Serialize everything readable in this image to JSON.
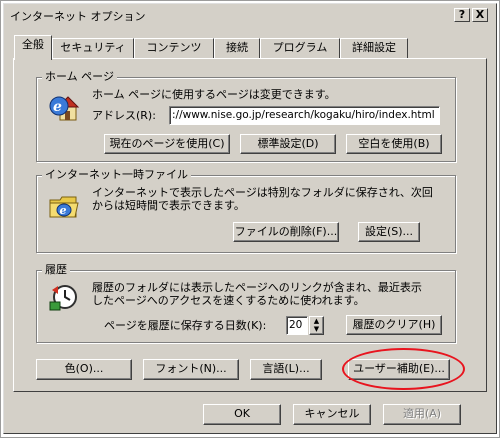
{
  "window": {
    "title": "インターネット オプション",
    "help_label": "?",
    "close_label": "X"
  },
  "tabs": [
    {
      "label": "全般",
      "active": true
    },
    {
      "label": "セキュリティ",
      "active": false
    },
    {
      "label": "コンテンツ",
      "active": false
    },
    {
      "label": "接続",
      "active": false
    },
    {
      "label": "プログラム",
      "active": false
    },
    {
      "label": "詳細設定",
      "active": false
    }
  ],
  "home_page": {
    "legend": "ホーム ページ",
    "description": "ホーム ページに使用するページは変更できます。",
    "address_label": "アドレス(R):",
    "address_value": "://www.nise.go.jp/research/kogaku/hiro/index.html",
    "btn_use_current": "現在のページを使用(C)",
    "btn_use_default": "標準設定(D)",
    "btn_use_blank": "空白を使用(B)",
    "icon": "home-page-icon"
  },
  "temp_files": {
    "legend": "インターネット一時ファイル",
    "description_line1": "インターネットで表示したページは特別なフォルダに保存され、次回",
    "description_line2": "からは短時間で表示できます。",
    "btn_delete_files": "ファイルの削除(F)...",
    "btn_settings": "設定(S)...",
    "icon": "temp-files-icon"
  },
  "history": {
    "legend": "履歴",
    "description_line1": "履歴のフォルダには表示したページへのリンクが含まれ、最近表示",
    "description_line2": "したページへのアクセスを速くするために使われます。",
    "days_label": "ページを履歴に保存する日数(K):",
    "days_value": "20",
    "btn_clear_history": "履歴のクリア(H)",
    "icon": "history-icon"
  },
  "bottom_buttons": {
    "colors": "色(O)...",
    "fonts": "フォント(N)...",
    "languages": "言語(L)...",
    "accessibility": "ユーザー補助(E)..."
  },
  "dialog_buttons": {
    "ok": "OK",
    "cancel": "キャンセル",
    "apply": "適用(A)"
  },
  "colors": {
    "dialog_bg": "#d4d0c8",
    "highlight_ellipse": "#e8141e"
  }
}
